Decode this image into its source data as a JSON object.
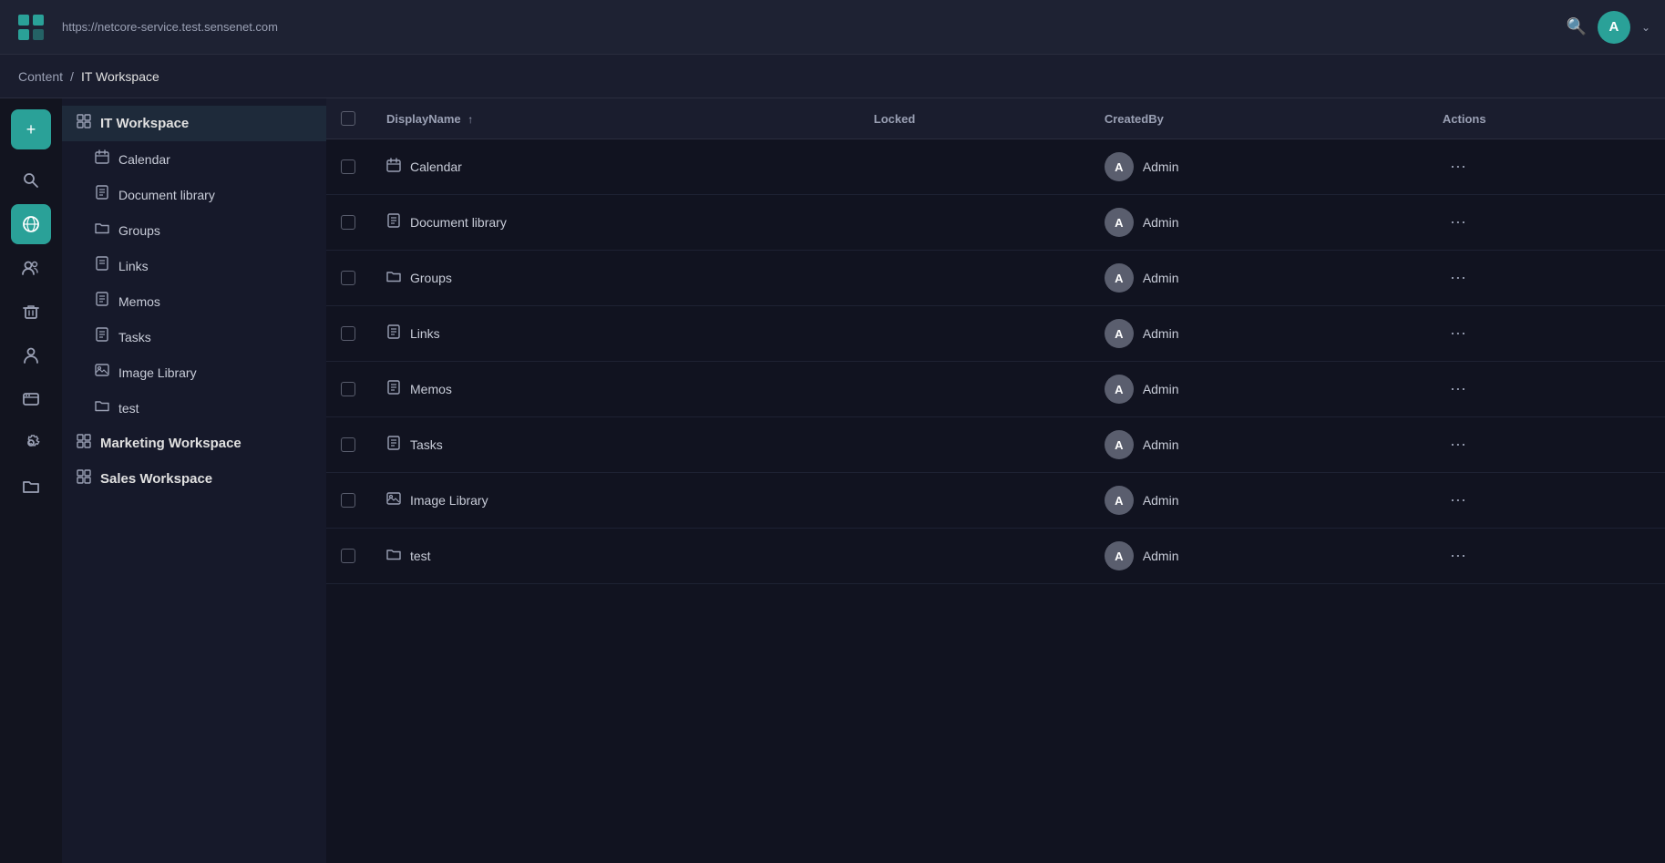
{
  "topbar": {
    "url": "https://netcore-service.test.sensenet.com",
    "avatar_letter": "A",
    "search_icon": "🔍"
  },
  "breadcrumb": {
    "root": "Content",
    "separator": "/",
    "current": "IT Workspace"
  },
  "icon_sidebar": {
    "items": [
      {
        "id": "add",
        "icon": "+",
        "label": "add-button",
        "active": false,
        "add": true
      },
      {
        "id": "search",
        "icon": "⌕",
        "label": "search-icon",
        "active": false
      },
      {
        "id": "globe",
        "icon": "🌐",
        "label": "globe-icon",
        "active": true
      },
      {
        "id": "users",
        "icon": "👥",
        "label": "users-icon",
        "active": false
      },
      {
        "id": "trash",
        "icon": "🗑",
        "label": "trash-icon",
        "active": false
      },
      {
        "id": "groups",
        "icon": "👤",
        "label": "groups-icon",
        "active": false
      },
      {
        "id": "web",
        "icon": "🌍",
        "label": "web-icon",
        "active": false
      },
      {
        "id": "tools",
        "icon": "🔧",
        "label": "tools-icon",
        "active": false
      },
      {
        "id": "folder",
        "icon": "📁",
        "label": "folder-icon",
        "active": false
      }
    ]
  },
  "tree_sidebar": {
    "items": [
      {
        "id": "it-workspace",
        "label": "IT Workspace",
        "icon": "grid",
        "level": "parent",
        "active": true
      },
      {
        "id": "calendar",
        "label": "Calendar",
        "icon": "calendar",
        "level": "child",
        "active": false
      },
      {
        "id": "document-library",
        "label": "Document library",
        "icon": "doc",
        "level": "child",
        "active": false
      },
      {
        "id": "groups",
        "label": "Groups",
        "icon": "folder",
        "level": "child",
        "active": false
      },
      {
        "id": "links",
        "label": "Links",
        "icon": "doc",
        "level": "child",
        "active": false
      },
      {
        "id": "memos",
        "label": "Memos",
        "icon": "doc",
        "level": "child",
        "active": false
      },
      {
        "id": "tasks",
        "label": "Tasks",
        "icon": "doc",
        "level": "child",
        "active": false
      },
      {
        "id": "image-library",
        "label": "Image Library",
        "icon": "image",
        "level": "child",
        "active": false
      },
      {
        "id": "test",
        "label": "test",
        "icon": "folder",
        "level": "child",
        "active": false
      },
      {
        "id": "marketing-workspace",
        "label": "Marketing Workspace",
        "icon": "grid",
        "level": "parent",
        "active": false
      },
      {
        "id": "sales-workspace",
        "label": "Sales Workspace",
        "icon": "grid",
        "level": "parent",
        "active": false
      }
    ]
  },
  "table": {
    "columns": [
      {
        "id": "checkbox",
        "label": ""
      },
      {
        "id": "display-name",
        "label": "DisplayName",
        "sortable": true,
        "sort": "asc"
      },
      {
        "id": "locked",
        "label": "Locked"
      },
      {
        "id": "created-by",
        "label": "CreatedBy"
      },
      {
        "id": "actions",
        "label": "Actions"
      }
    ],
    "rows": [
      {
        "id": "calendar-row",
        "icon": "calendar",
        "name": "Calendar",
        "locked": "",
        "created_by": "Admin",
        "avatar": "A"
      },
      {
        "id": "doc-library-row",
        "icon": "doc",
        "name": "Document library",
        "locked": "",
        "created_by": "Admin",
        "avatar": "A"
      },
      {
        "id": "groups-row",
        "icon": "folder",
        "name": "Groups",
        "locked": "",
        "created_by": "Admin",
        "avatar": "A"
      },
      {
        "id": "links-row",
        "icon": "doc",
        "name": "Links",
        "locked": "",
        "created_by": "Admin",
        "avatar": "A"
      },
      {
        "id": "memos-row",
        "icon": "doc",
        "name": "Memos",
        "locked": "",
        "created_by": "Admin",
        "avatar": "A"
      },
      {
        "id": "tasks-row",
        "icon": "doc",
        "name": "Tasks",
        "locked": "",
        "created_by": "Admin",
        "avatar": "A"
      },
      {
        "id": "image-library-row",
        "icon": "image",
        "name": "Image Library",
        "locked": "",
        "created_by": "Admin",
        "avatar": "A"
      },
      {
        "id": "test-row",
        "icon": "folder",
        "name": "test",
        "locked": "",
        "created_by": "Admin",
        "avatar": "A"
      }
    ]
  }
}
